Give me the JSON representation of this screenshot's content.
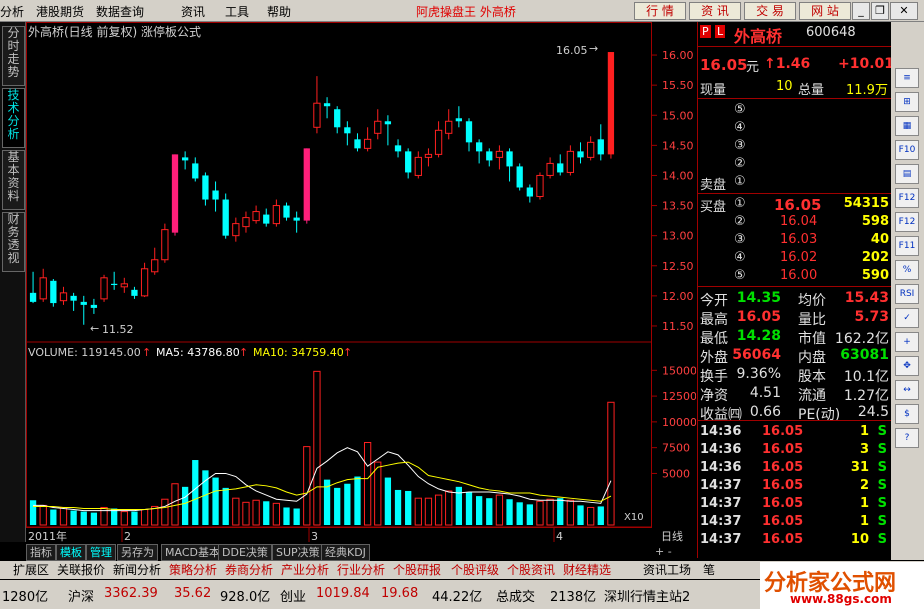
{
  "menu": {
    "items": [
      "分析",
      "港股期货",
      "数据查询",
      "资讯",
      "工具",
      "帮助"
    ],
    "app_title": "阿虎操盘王 外高桥",
    "tool_buttons": [
      "行 情",
      "资 讯",
      "交 易",
      "网 站"
    ]
  },
  "left_tabs": [
    "分时走势",
    "技术分析",
    "基本资料",
    "财务透视"
  ],
  "chart": {
    "header": "外高桥(日线 前复权) 涨停板公式",
    "high_label": "16.05",
    "low_label": "11.52",
    "volume_label": "VOLUME: 119145.00",
    "ma5_label": "MA5: 43786.80",
    "ma10_label": "MA10: 34759.40",
    "period": "日线",
    "scale_note": "X10",
    "month_labels": [
      "2011年",
      "2",
      "3",
      "4"
    ]
  },
  "chart_data": [
    {
      "type": "candlestick",
      "title": "外高桥(日线 前复权) 涨停板公式",
      "ylim": [
        11.3,
        16.25
      ],
      "y_ticks": [
        11.5,
        12.0,
        12.5,
        13.0,
        13.5,
        14.0,
        14.5,
        15.0,
        15.5,
        16.0
      ],
      "candles": [
        {
          "o": 12.05,
          "c": 11.9,
          "h": 12.4,
          "l": 11.88
        },
        {
          "o": 11.95,
          "c": 12.3,
          "h": 12.45,
          "l": 11.9
        },
        {
          "o": 12.25,
          "c": 11.88,
          "h": 12.28,
          "l": 11.82
        },
        {
          "o": 11.92,
          "c": 12.05,
          "h": 12.15,
          "l": 11.85
        },
        {
          "o": 12.0,
          "c": 11.92,
          "h": 12.05,
          "l": 11.75
        },
        {
          "o": 11.9,
          "c": 11.85,
          "h": 12.0,
          "l": 11.52
        },
        {
          "o": 11.85,
          "c": 11.8,
          "h": 11.95,
          "l": 11.7
        },
        {
          "o": 11.95,
          "c": 12.3,
          "h": 12.35,
          "l": 11.9
        },
        {
          "o": 12.2,
          "c": 12.18,
          "h": 12.4,
          "l": 12.1
        },
        {
          "o": 12.15,
          "c": 12.2,
          "h": 12.3,
          "l": 12.05
        },
        {
          "o": 12.1,
          "c": 12.0,
          "h": 12.15,
          "l": 11.95
        },
        {
          "o": 12.0,
          "c": 12.45,
          "h": 12.55,
          "l": 11.98
        },
        {
          "o": 12.4,
          "c": 12.6,
          "h": 12.8,
          "l": 12.35
        },
        {
          "o": 12.6,
          "c": 13.1,
          "h": 13.2,
          "l": 12.55
        },
        {
          "o": 13.05,
          "c": 14.35,
          "h": 14.35,
          "l": 13.0,
          "limit": true
        },
        {
          "o": 14.3,
          "c": 14.25,
          "h": 14.4,
          "l": 14.1
        },
        {
          "o": 14.2,
          "c": 13.95,
          "h": 14.3,
          "l": 13.9
        },
        {
          "o": 14.0,
          "c": 13.6,
          "h": 14.05,
          "l": 13.5
        },
        {
          "o": 13.75,
          "c": 13.6,
          "h": 13.9,
          "l": 13.4
        },
        {
          "o": 13.6,
          "c": 13.0,
          "h": 13.7,
          "l": 12.95
        },
        {
          "o": 13.0,
          "c": 13.2,
          "h": 13.3,
          "l": 12.9
        },
        {
          "o": 13.15,
          "c": 13.3,
          "h": 13.4,
          "l": 13.05
        },
        {
          "o": 13.25,
          "c": 13.4,
          "h": 13.5,
          "l": 13.2
        },
        {
          "o": 13.35,
          "c": 13.2,
          "h": 13.45,
          "l": 13.15
        },
        {
          "o": 13.2,
          "c": 13.5,
          "h": 13.6,
          "l": 13.15
        },
        {
          "o": 13.5,
          "c": 13.3,
          "h": 13.55,
          "l": 13.25
        },
        {
          "o": 13.3,
          "c": 13.25,
          "h": 13.4,
          "l": 13.05
        },
        {
          "o": 13.25,
          "c": 14.45,
          "h": 14.45,
          "l": 13.2,
          "limit": true
        },
        {
          "o": 14.8,
          "c": 15.2,
          "h": 15.65,
          "l": 14.7
        },
        {
          "o": 15.2,
          "c": 15.15,
          "h": 15.3,
          "l": 14.95
        },
        {
          "o": 15.1,
          "c": 14.8,
          "h": 15.15,
          "l": 14.7
        },
        {
          "o": 14.8,
          "c": 14.7,
          "h": 14.9,
          "l": 14.5
        },
        {
          "o": 14.6,
          "c": 14.45,
          "h": 14.7,
          "l": 14.4
        },
        {
          "o": 14.45,
          "c": 14.6,
          "h": 14.8,
          "l": 14.4
        },
        {
          "o": 14.7,
          "c": 14.9,
          "h": 15.1,
          "l": 14.6
        },
        {
          "o": 14.9,
          "c": 14.85,
          "h": 15.0,
          "l": 14.5
        },
        {
          "o": 14.5,
          "c": 14.4,
          "h": 14.6,
          "l": 14.3
        },
        {
          "o": 14.4,
          "c": 14.05,
          "h": 14.45,
          "l": 13.95
        },
        {
          "o": 14.0,
          "c": 14.3,
          "h": 14.4,
          "l": 13.95
        },
        {
          "o": 14.3,
          "c": 14.35,
          "h": 14.45,
          "l": 14.15
        },
        {
          "o": 14.35,
          "c": 14.75,
          "h": 14.9,
          "l": 14.3
        },
        {
          "o": 14.7,
          "c": 14.9,
          "h": 15.1,
          "l": 14.6
        },
        {
          "o": 14.95,
          "c": 14.9,
          "h": 15.15,
          "l": 14.8
        },
        {
          "o": 14.9,
          "c": 14.55,
          "h": 14.95,
          "l": 14.4
        },
        {
          "o": 14.55,
          "c": 14.4,
          "h": 14.6,
          "l": 14.2
        },
        {
          "o": 14.4,
          "c": 14.25,
          "h": 14.45,
          "l": 14.15
        },
        {
          "o": 14.3,
          "c": 14.4,
          "h": 14.5,
          "l": 14.1
        },
        {
          "o": 14.4,
          "c": 14.15,
          "h": 14.45,
          "l": 13.9
        },
        {
          "o": 14.15,
          "c": 13.8,
          "h": 14.2,
          "l": 13.75
        },
        {
          "o": 13.8,
          "c": 13.65,
          "h": 13.85,
          "l": 13.55
        },
        {
          "o": 13.65,
          "c": 14.0,
          "h": 14.05,
          "l": 13.6
        },
        {
          "o": 14.0,
          "c": 14.2,
          "h": 14.3,
          "l": 13.95
        },
        {
          "o": 14.2,
          "c": 14.05,
          "h": 14.35,
          "l": 14.0
        },
        {
          "o": 14.05,
          "c": 14.4,
          "h": 14.5,
          "l": 14.0
        },
        {
          "o": 14.4,
          "c": 14.3,
          "h": 14.55,
          "l": 14.2
        },
        {
          "o": 14.3,
          "c": 14.55,
          "h": 14.65,
          "l": 14.25
        },
        {
          "o": 14.6,
          "c": 14.35,
          "h": 14.85,
          "l": 14.25
        },
        {
          "o": 14.35,
          "c": 16.05,
          "h": 16.05,
          "l": 14.28,
          "limit": true
        }
      ]
    },
    {
      "type": "bar",
      "title": "VOLUME",
      "ylim": [
        0,
        16000
      ],
      "y_ticks": [
        5000,
        7500,
        10000,
        12500,
        15000
      ],
      "unit_note": "X10",
      "volumes": [
        2400,
        1900,
        1500,
        1700,
        1400,
        1300,
        1200,
        1700,
        1600,
        1300,
        1300,
        1500,
        1800,
        2500,
        4000,
        3700,
        6300,
        5300,
        4600,
        3600,
        2600,
        2200,
        2400,
        2300,
        2100,
        1700,
        1600,
        7600,
        14900,
        4400,
        3600,
        4000,
        4700,
        8000,
        6100,
        4600,
        3400,
        3300,
        2600,
        2600,
        2900,
        3300,
        3700,
        3200,
        2800,
        2600,
        2900,
        2500,
        2200,
        2000,
        2300,
        2500,
        2600,
        2400,
        1900,
        1700,
        1800,
        11900
      ],
      "ma5": [
        1900,
        1900,
        1700,
        1600,
        1500,
        1400,
        1400,
        1400,
        1400,
        1400,
        1400,
        1500,
        1600,
        1800,
        2300,
        2700,
        3500,
        4300,
        5000,
        5000,
        4700,
        3900,
        3300,
        2900,
        2500,
        2400,
        2300,
        3000,
        5500,
        6200,
        7000,
        7500,
        7100,
        5700,
        6400,
        7100,
        6800,
        5800,
        4700,
        4000,
        3500,
        3200,
        3100,
        3200,
        3200,
        3200,
        3100,
        3000,
        2800,
        2500,
        2400,
        2400,
        2400,
        2300,
        2300,
        2200,
        2100,
        4300
      ],
      "ma10": [
        1800,
        1800,
        1800,
        1700,
        1700,
        1600,
        1600,
        1600,
        1500,
        1500,
        1500,
        1500,
        1600,
        1700,
        1900,
        2100,
        2500,
        2900,
        3300,
        3400,
        3500,
        3700,
        3900,
        3800,
        3600,
        3200,
        2900,
        3100,
        3700,
        3700,
        4100,
        4400,
        4500,
        4500,
        5600,
        5800,
        6000,
        6100,
        5600,
        4800,
        4600,
        4400,
        4200,
        3900,
        3600,
        3400,
        3300,
        3100,
        3100,
        3100,
        2900,
        2800,
        2700,
        2600,
        2500,
        2400,
        2300,
        2800
      ],
      "legend": [
        "VOLUME: 119145.00",
        "MA5: 43786.80",
        "MA10: 34759.40"
      ]
    }
  ],
  "quote": {
    "badge_p": "P",
    "badge_l": "L",
    "name": "外高桥",
    "code": "600648",
    "price": "16.05",
    "price_unit": "元",
    "change": "↑1.46",
    "change_pct": "+10.01",
    "xianliang_label": "现量",
    "xianliang": "10",
    "zongliang_label": "总量",
    "zongliang": "11.9万",
    "sell_label": "卖盘",
    "sell_levels": [
      "⑤",
      "④",
      "③",
      "②",
      "①"
    ],
    "buy_label": "买盘",
    "buy": [
      {
        "lvl": "①",
        "price": "16.05",
        "vol": "54315"
      },
      {
        "lvl": "②",
        "price": "16.04",
        "vol": "598"
      },
      {
        "lvl": "③",
        "price": "16.03",
        "vol": "40"
      },
      {
        "lvl": "④",
        "price": "16.02",
        "vol": "202"
      },
      {
        "lvl": "⑤",
        "price": "16.00",
        "vol": "590"
      }
    ],
    "stats": [
      {
        "l1": "今开",
        "v1": "14.35",
        "c1": "green",
        "l2": "均价",
        "v2": "15.43",
        "c2": "red"
      },
      {
        "l1": "最高",
        "v1": "16.05",
        "c1": "red",
        "l2": "量比",
        "v2": "5.73",
        "c2": "red"
      },
      {
        "l1": "最低",
        "v1": "14.28",
        "c1": "green",
        "l2": "市值",
        "v2": "162.2亿",
        "c2": "white"
      },
      {
        "l1": "外盘",
        "v1": "56064",
        "c1": "red",
        "l2": "内盘",
        "v2": "63081",
        "c2": "green"
      },
      {
        "l1": "换手",
        "v1": "9.36%",
        "c1": "white",
        "l2": "股本",
        "v2": "10.1亿",
        "c2": "white"
      },
      {
        "l1": "净资",
        "v1": "4.51",
        "c1": "white",
        "l2": "流通",
        "v2": "1.27亿",
        "c2": "white"
      },
      {
        "l1": "收益㈣",
        "v1": "0.66",
        "c1": "white",
        "l2": "PE(动)",
        "v2": "24.5",
        "c2": "white"
      }
    ],
    "ticks": [
      {
        "t": "14:36",
        "p": "16.05",
        "v": "1",
        "s": "S"
      },
      {
        "t": "14:36",
        "p": "16.05",
        "v": "3",
        "s": "S"
      },
      {
        "t": "14:36",
        "p": "16.05",
        "v": "31",
        "s": "S"
      },
      {
        "t": "14:37",
        "p": "16.05",
        "v": "2",
        "s": "S"
      },
      {
        "t": "14:37",
        "p": "16.05",
        "v": "1",
        "s": "S"
      },
      {
        "t": "14:37",
        "p": "16.05",
        "v": "1",
        "s": "S"
      },
      {
        "t": "14:37",
        "p": "16.05",
        "v": "10",
        "s": "S"
      }
    ]
  },
  "right_toolbar": [
    "≡",
    "⊞",
    "▦",
    "F10",
    "▤",
    "F12",
    "F12",
    "F11",
    "%",
    "RSI",
    "✓",
    "+",
    "✥",
    "↔",
    "$",
    "?"
  ],
  "bottom_tabs": [
    "指标",
    "模板",
    "管理",
    "另存为",
    "MACD基本",
    "DDE决策",
    "SUP决策",
    "经典KDJ"
  ],
  "bottom_tab_right": "+  -",
  "func_bar": [
    "扩展区",
    "关联报价",
    "新闻分析",
    "策略分析",
    "券商分析",
    "产业分析",
    "行业分析",
    "个股研报",
    "个股评级",
    "个股资讯",
    "财经精选",
    "资讯工场",
    "笔"
  ],
  "status": {
    "a": "1280亿",
    "hs_label": "沪深",
    "hs_value": "3362.39",
    "hs_change": "35.62",
    "hs_amount": "928.0亿",
    "cy_label": "创业",
    "cy_value": "1019.84",
    "cy_change": "19.68",
    "cy_amount": "44.22亿",
    "total_label": "总成交",
    "total_value": "2138亿",
    "server": "深圳行情主站2"
  },
  "brand": {
    "text": "分析家公式网",
    "url": "www.88gs.com"
  },
  "colors": {
    "up_red": "#ff2020",
    "down_cyan": "#00ffff",
    "limit_magenta": "#ff1f7a",
    "grid_red": "#a00000"
  }
}
